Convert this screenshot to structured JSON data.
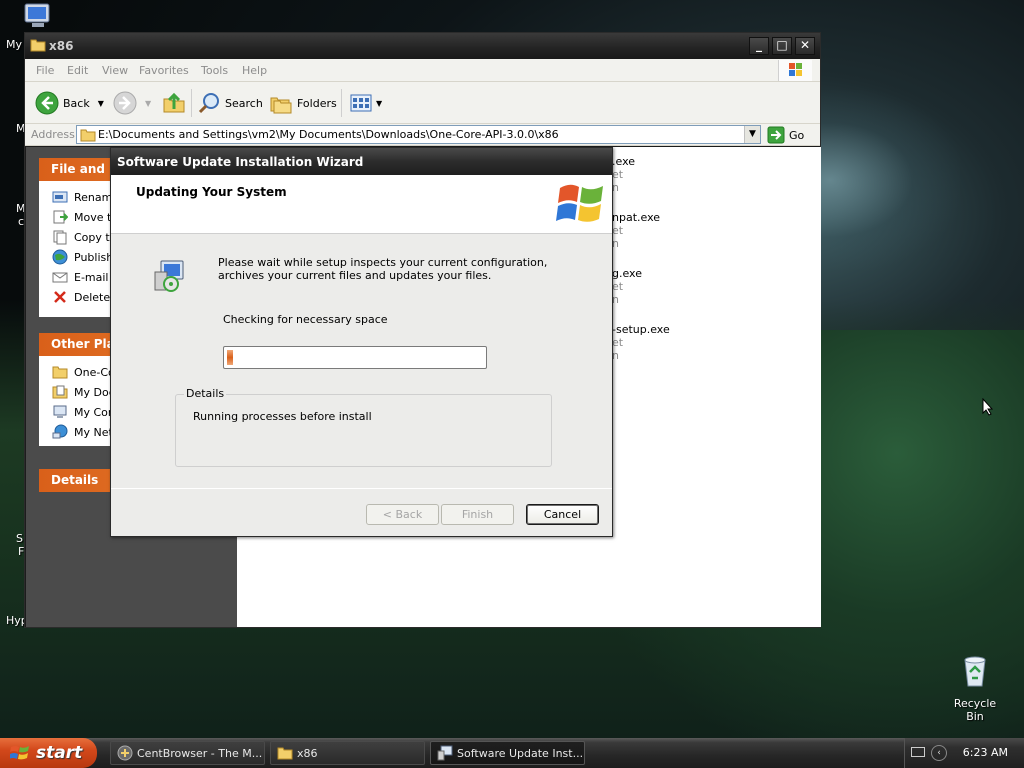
{
  "desktop": {
    "labels": {
      "my_computer": "My",
      "m1": "M",
      "m2": "M",
      "m3": "c",
      "s1": "S",
      "s2": "F",
      "hyp": "Hyp"
    },
    "recycle_bin_label": "Recycle Bin"
  },
  "explorer": {
    "title": "x86",
    "menu": [
      "File",
      "Edit",
      "View",
      "Favorites",
      "Tools",
      "Help"
    ],
    "toolbar": {
      "back": "Back",
      "search": "Search",
      "folders": "Folders"
    },
    "address": {
      "label": "Address",
      "value": "E:\\Documents and Settings\\vm2\\My Documents\\Downloads\\One-Core-API-3.0.0\\x86",
      "go": "Go"
    },
    "file_tasks": {
      "title": "File and Fo",
      "items": [
        "Rename",
        "Move th",
        "Copy th",
        "Publish",
        "E-mail t",
        "Delete t"
      ]
    },
    "other_places": {
      "title": "Other Plac",
      "items": [
        "One-Co",
        "My Doc",
        "My Com",
        "My Netw"
      ]
    },
    "details_title": "Details",
    "files": [
      {
        "name": ".exe",
        "sub1": "et",
        "sub2": "n"
      },
      {
        "name": "npat.exe",
        "sub1": "et",
        "sub2": "n"
      },
      {
        "name": "g.exe",
        "sub1": "et",
        "sub2": "n"
      },
      {
        "name": "-setup.exe",
        "sub1": "et",
        "sub2": "n"
      }
    ]
  },
  "wizard": {
    "title": "Software Update Installation Wizard",
    "header": "Updating Your System",
    "message": "Please wait while setup inspects your current configuration, archives your current files and updates your files.",
    "status": "Checking for necessary space",
    "progress_fraction": 0.04,
    "details_label": "Details",
    "details_text": "Running processes before install",
    "buttons": {
      "back": "< Back",
      "finish": "Finish",
      "cancel": "Cancel"
    }
  },
  "taskbar": {
    "start": "start",
    "tasks": [
      "CentBrowser - The M...",
      "x86",
      "Software Update Inst..."
    ],
    "clock": "6:23 AM"
  },
  "colors": {
    "accent_orange": "#d9601a",
    "title_dark": "#2c2c2c"
  }
}
